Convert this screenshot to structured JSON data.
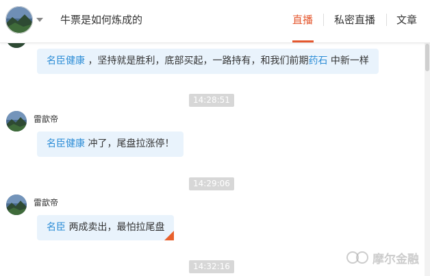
{
  "header": {
    "title": "牛票是如何炼成的",
    "tabs": [
      {
        "label": "直播",
        "active": true
      },
      {
        "label": "私密直播",
        "active": false
      },
      {
        "label": "文章",
        "active": false
      }
    ]
  },
  "messages": [
    {
      "user": "",
      "parts": [
        {
          "text": "名臣健康",
          "highlight": true
        },
        {
          "text": "，坚持就是胜利，底部买起，一路持有，和我们前期",
          "highlight": false
        },
        {
          "text": "药石",
          "highlight": true
        },
        {
          "text": "中新一样",
          "highlight": false
        }
      ]
    },
    {
      "time": "14:28:51"
    },
    {
      "user": "雷歆帝",
      "parts": [
        {
          "text": "名臣健康",
          "highlight": true
        },
        {
          "text": "冲了，尾盘拉涨停！",
          "highlight": false
        }
      ]
    },
    {
      "time": "14:29:06"
    },
    {
      "user": "雷歆帝",
      "parts": [
        {
          "text": "名臣",
          "highlight": true
        },
        {
          "text": "两成卖出，最怕拉尾盘",
          "highlight": false
        }
      ]
    },
    {
      "time": "14:32:16"
    }
  ],
  "watermark": "摩尔金融",
  "colors": {
    "accent": "#e4572e",
    "highlight": "#2b8cd6",
    "bubble": "#e9f3fc",
    "time_badge": "#d7d7d7"
  }
}
